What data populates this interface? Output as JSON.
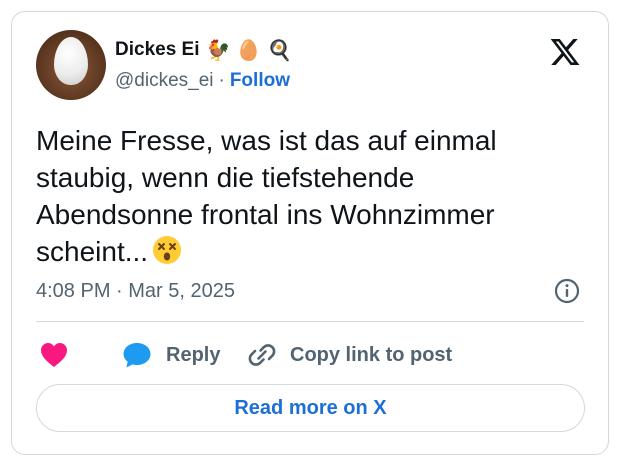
{
  "author": {
    "display_name": "Dickes Ei",
    "name_emojis": [
      "🐓",
      "🥚",
      "🍳"
    ],
    "handle": "@dickes_ei",
    "separator": "·",
    "follow_label": "Follow"
  },
  "tweet": {
    "text": "Meine Fresse, was ist das auf einmal staubig, wenn die tiefstehende Abendsonne frontal ins Wohnzimmer scheint...",
    "emoji_icon": "dizzy-face-emoji",
    "timestamp": "4:08 PM · Mar 5, 2025"
  },
  "actions": {
    "reply_label": "Reply",
    "copy_link_label": "Copy link to post",
    "read_more_label": "Read more on X"
  },
  "colors": {
    "link_blue": "#1d6fd8",
    "heart_pink": "#f91880",
    "reply_blue": "#1d9bf0",
    "muted": "#536471",
    "border": "#cfd9de"
  }
}
